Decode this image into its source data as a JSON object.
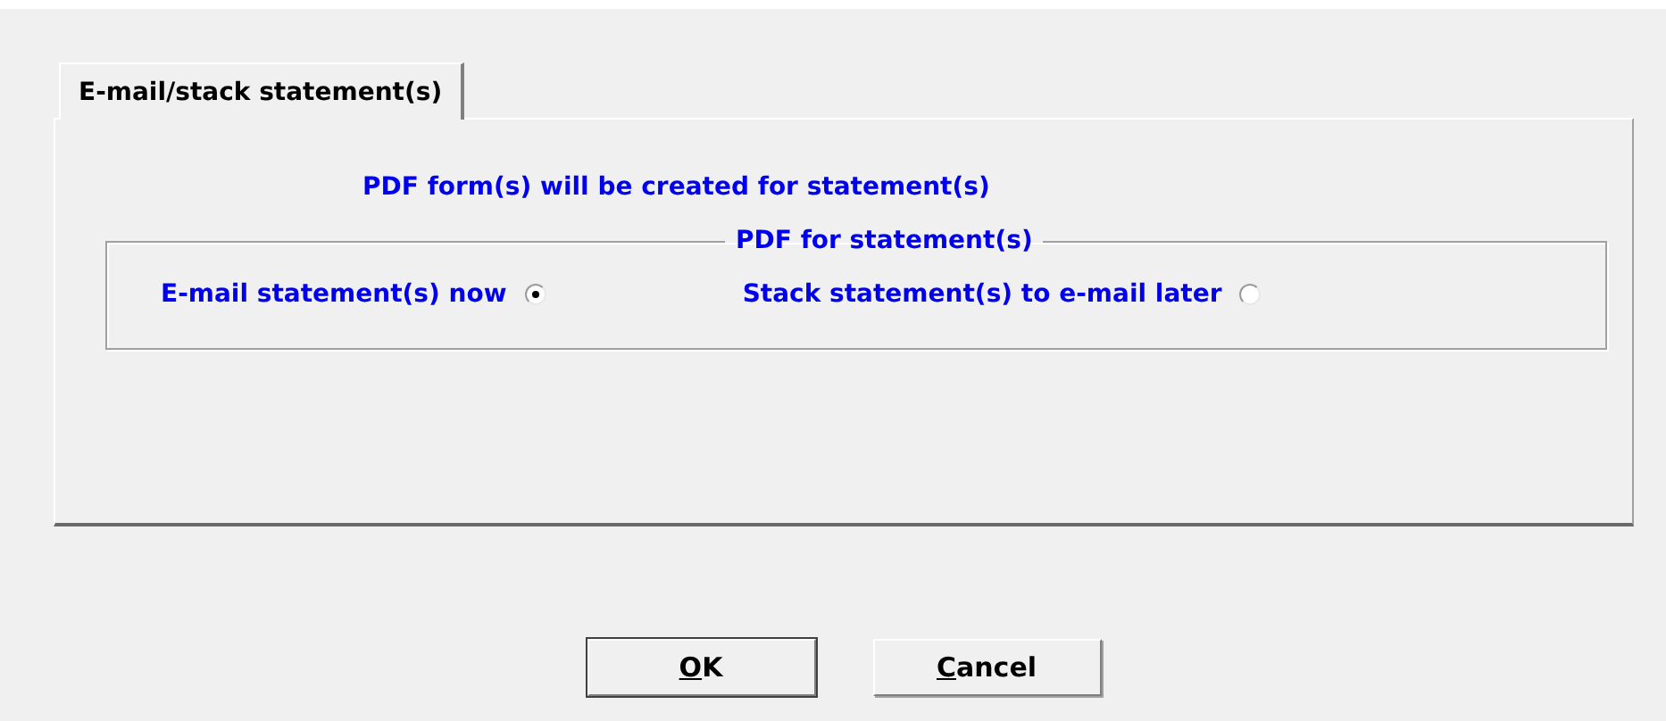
{
  "tabs": [
    {
      "label": "E-mail/stack statement(s)",
      "selected": true
    }
  ],
  "message": "PDF form(s) will be created for statement(s)",
  "group": {
    "title": "PDF for statement(s)",
    "options": [
      {
        "label": "E-mail statement(s) now",
        "selected": true
      },
      {
        "label": "Stack statement(s) to e-mail later",
        "selected": false
      }
    ]
  },
  "buttons": [
    {
      "label": "OK",
      "default": true
    },
    {
      "label": "Cancel",
      "default": false
    }
  ]
}
